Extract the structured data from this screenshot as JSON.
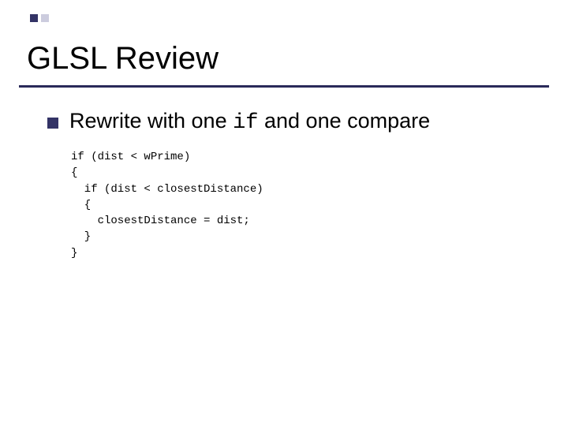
{
  "title": "GLSL Review",
  "bullet": {
    "pre": "Rewrite with one ",
    "code": "if",
    "post": " and one compare"
  },
  "code": {
    "l1": "if (dist < wPrime)",
    "l2": "{",
    "l3": "  if (dist < closestDistance)",
    "l4": "  {",
    "l5": "    closestDistance = dist;",
    "l6": "  }",
    "l7": "}"
  }
}
